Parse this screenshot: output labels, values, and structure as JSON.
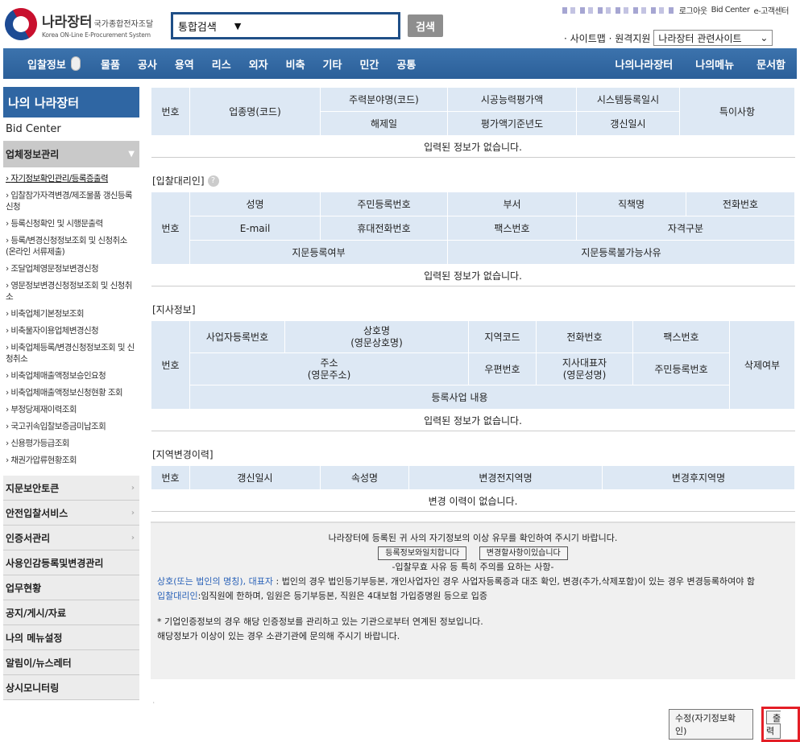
{
  "header": {
    "logo_main": "나라장터",
    "logo_small": "국가종합전자조달",
    "logo_sub": "Korea ON-Line E-Procurement System",
    "search_select": "통합검색",
    "search_button": "검색",
    "top_links": [
      "로그아웃",
      "Bid Center",
      "e-고객센터"
    ],
    "site_links": "· 사이트맵 · 원격지원",
    "site_select": "나라장터 관련사이트"
  },
  "nav": {
    "first": "입찰정보",
    "items": [
      "물품",
      "공사",
      "용역",
      "리스",
      "외자",
      "비축",
      "기타",
      "민간",
      "공통"
    ],
    "right": [
      "나의나라장터",
      "나의메뉴",
      "문서함"
    ]
  },
  "sidebar": {
    "title": "나의 나라장터",
    "bid": "Bid Center",
    "open_section": "업체정보관리",
    "sub_items": [
      "자기정보확인관리/등록증출력",
      "입찰참가자격변경/제조물품 갱신등록 신청",
      "등록신청확인 및 시행문출력",
      "등록/변경신청정보조회 및 신청취소(온라인 서류제출)",
      "조달업체영문정보변경신청",
      "영문정보변경신청정보조회 및 신청취소",
      "비축업체기본정보조회",
      "비축물자이용업체변경신청",
      "비축업체등록/변경신청정보조회 및 신청취소",
      "비축업체매출액정보승인요청",
      "비축업체매출액정보신청현황 조회",
      "부정당제재이력조회",
      "국고귀속입찰보증금미납조회",
      "신용평가등급조회",
      "채권가압류현황조회"
    ],
    "sections": [
      "지문보안토큰",
      "안전입찰서비스",
      "인증서관리",
      "사용인감등록및변경관리",
      "업무현황",
      "공지/게시/자료",
      "나의 메뉴설정",
      "알림이/뉴스레터",
      "상시모니터링"
    ]
  },
  "table1": {
    "h_no": "번호",
    "h_name": "업종명(코드)",
    "h_main": "주력분야명(코드)",
    "h_eval": "시공능력평가액",
    "h_reg": "시스템등록일시",
    "h_note": "특이사항",
    "h_cancel": "해제일",
    "h_year": "평가액기준년도",
    "h_renew": "갱신일시",
    "empty": "입력된 정보가 없습니다."
  },
  "agent": {
    "title": "[입찰대리인]",
    "h_no": "번호",
    "h_name": "성명",
    "h_ssn": "주민등록번호",
    "h_dept": "부서",
    "h_pos": "직책명",
    "h_tel": "전화번호",
    "h_email": "E-mail",
    "h_mobile": "휴대전화번호",
    "h_fax": "팩스번호",
    "h_qual": "자격구분",
    "h_finger": "지문등록여부",
    "h_finger_no": "지문등록불가능사유",
    "empty": "입력된 정보가 없습니다."
  },
  "branch": {
    "title": "[지사정보]",
    "h_no": "번호",
    "h_biz": "사업자등록번호",
    "h_company": "상호명",
    "h_company_en": "(영문상호명)",
    "h_region": "지역코드",
    "h_tel": "전화번호",
    "h_fax": "팩스번호",
    "h_del": "삭제여부",
    "h_addr": "주소",
    "h_addr_en": "(영문주소)",
    "h_zip": "우편번호",
    "h_rep": "지사대표자",
    "h_rep_en": "(영문성명)",
    "h_ssn": "주민등록번호",
    "h_biz_content": "등록사업 내용",
    "empty": "입력된 정보가 없습니다."
  },
  "region": {
    "title": "[지역변경이력]",
    "h_no": "번호",
    "h_renew": "갱신일시",
    "h_attr": "속성명",
    "h_before": "변경전지역명",
    "h_after": "변경후지역명",
    "empty": "변경 이력이 없습니다."
  },
  "notice": {
    "line1": "나라장터에 등록된 귀 사의 자기정보의 이상 유무를 확인하여 주시기 바랍니다.",
    "btn_match": "등록정보와일치합니다",
    "btn_change": "변경할사항이있습니다",
    "caution": "-입찰무효 사유 등 특히 주의를 요하는 사항-",
    "p1_blue": "상호(또는 법인의 명칭), 대표자",
    "p1_text": " : 법인의 경우 법인등기부등본, 개인사업자인 경우 사업자등록증과 대조 확인, 변경(추가,삭제포함)이 있는 경우 변경등록하여야 함",
    "p2_blue": "입찰대리인",
    "p2_text": ":임직원에 한하며, 임원은 등기부등본, 직원은 4대보험 가입증명원 등으로 입증",
    "p3": "* 기업인증정보의 경우 해당 인증정보를 관리하고 있는 기관으로부터 연계된 정보입니다.",
    "p4": "해당정보가 이상이 있는 경우 소관기관에 문의해 주시기 바랍니다."
  },
  "bottom": {
    "edit": "수정(자기정보확인)",
    "print": "출력"
  }
}
